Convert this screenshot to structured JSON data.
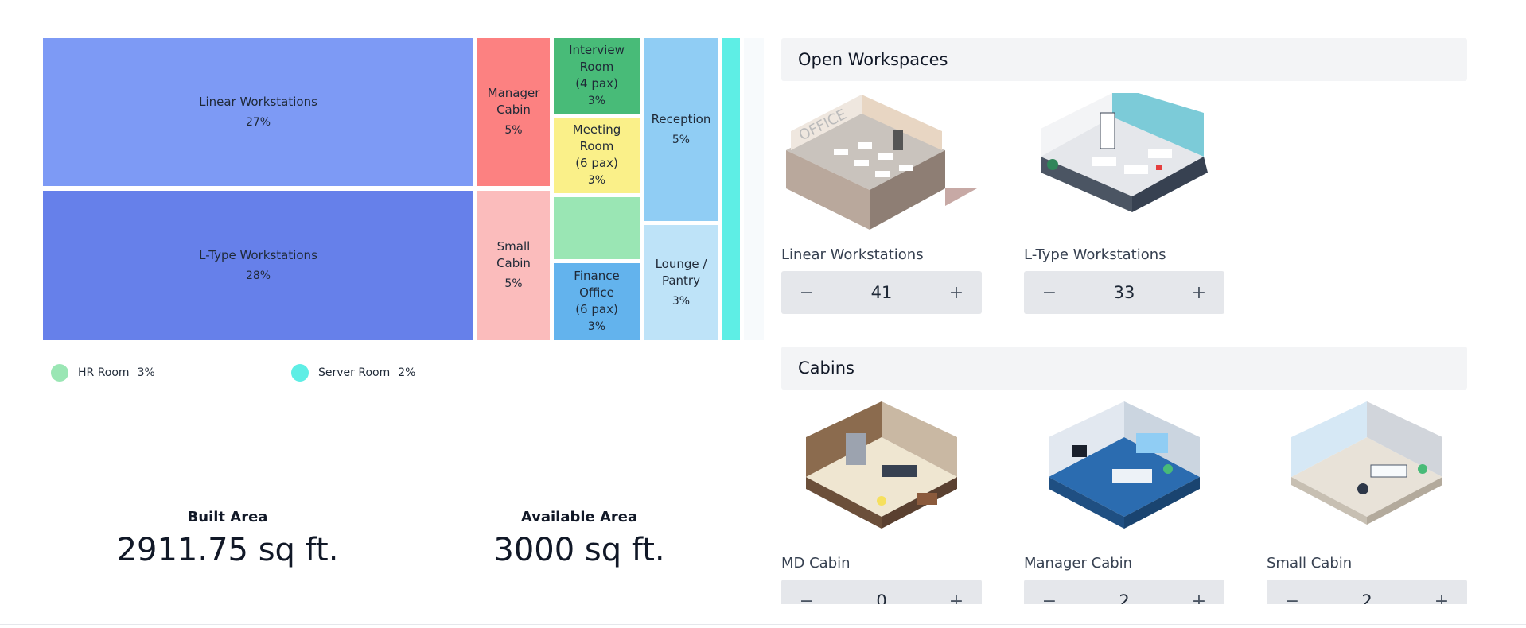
{
  "treemap": {
    "tiles": [
      {
        "label": "Linear Workstations",
        "pct": "27%",
        "color": "#7d9af5"
      },
      {
        "label": "L-Type Workstations",
        "pct": "28%",
        "color": "#6680ea"
      },
      {
        "label": "Manager\nCabin",
        "pct": "5%",
        "color": "#fc8181"
      },
      {
        "label": "Small\nCabin",
        "pct": "5%",
        "color": "#fbbcbc"
      },
      {
        "label": "Interview\nRoom\n(4 pax)",
        "pct": "3%",
        "color": "#48bb78"
      },
      {
        "label": "Meeting\nRoom\n(6 pax)",
        "pct": "3%",
        "color": "#faf089"
      },
      {
        "label": "",
        "pct": "",
        "color": "#9ae6b4"
      },
      {
        "label": "Finance\nOffice\n(6 pax)",
        "pct": "3%",
        "color": "#63b3ed"
      },
      {
        "label": "Reception",
        "pct": "5%",
        "color": "#90cdf4"
      },
      {
        "label": "Lounge /\nPantry",
        "pct": "3%",
        "color": "#bee3f8"
      },
      {
        "label": "",
        "pct": "",
        "color": "#5eeee5"
      },
      {
        "label": "",
        "pct": "",
        "color": "#f7fafc"
      }
    ]
  },
  "legend": [
    {
      "label": "HR Room",
      "pct": "3%",
      "color": "#9ae6b4"
    },
    {
      "label": "Server Room",
      "pct": "2%",
      "color": "#5eeee5"
    }
  ],
  "built_area": {
    "title": "Built Area",
    "value": "2911.75 sq ft."
  },
  "available_area": {
    "title": "Available Area",
    "value": "3000 sq ft."
  },
  "sections": {
    "open_workspaces": {
      "title": "Open Workspaces",
      "items": [
        {
          "name": "Linear Workstations",
          "value": "41"
        },
        {
          "name": "L-Type Workstations",
          "value": "33"
        }
      ]
    },
    "cabins": {
      "title": "Cabins",
      "items": [
        {
          "name": "MD Cabin",
          "value": "0"
        },
        {
          "name": "Manager Cabin",
          "value": "2"
        },
        {
          "name": "Small Cabin",
          "value": "2"
        }
      ]
    }
  },
  "stepper": {
    "minus": "−",
    "plus": "+"
  },
  "image_alt": {
    "office_img": "OFFICE"
  }
}
